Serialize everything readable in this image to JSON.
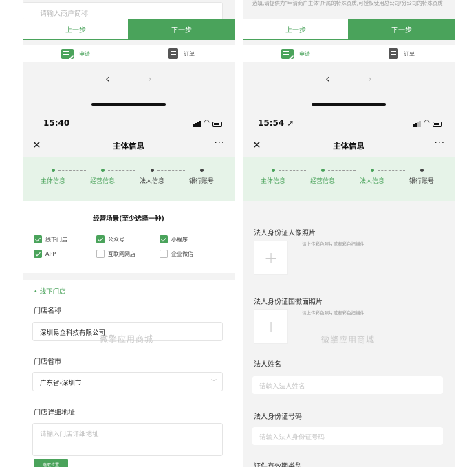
{
  "left_phone": {
    "remnant": {
      "input_placeholder": "请输入商户简称",
      "prev_label": "上一步",
      "next_label": "下一步",
      "tab_apply": "申请",
      "tab_order": "订单",
      "nav_back": "‹",
      "nav_forward": "›"
    },
    "status": {
      "time": "15:40"
    },
    "titlebar": {
      "close": "✕",
      "title": "主体信息",
      "more": "···"
    },
    "steps": [
      {
        "label": "主体信息",
        "state": "done"
      },
      {
        "label": "经营信息",
        "state": "done"
      },
      {
        "label": "法人信息",
        "state": "todo"
      },
      {
        "label": "银行账号",
        "state": "todo"
      }
    ],
    "scenario": {
      "title": "经营场景(至少选择一种)",
      "options": [
        {
          "label": "线下门店",
          "checked": true
        },
        {
          "label": "公众号",
          "checked": true
        },
        {
          "label": "小程序",
          "checked": true
        },
        {
          "label": "APP",
          "checked": true
        },
        {
          "label": "互联网网店",
          "checked": false
        },
        {
          "label": "企业微信",
          "checked": false
        }
      ]
    },
    "offline_store": {
      "heading": "• 线下门店",
      "name_label": "门店名称",
      "name_value": "深圳易企科技有限公司",
      "city_label": "门店省市",
      "city_value": "广东省-深圳市",
      "address_label": "门店详细地址",
      "address_placeholder": "请输入门店详细地址",
      "location_button": "选取位置"
    },
    "watermark": "微擎应用商城"
  },
  "right_phone": {
    "remnant": {
      "hint": "选填,请提供为\"申请商户主体\"所属的特殊资质,可授权使用总公司/分公司的特殊资质",
      "prev_label": "上一步",
      "next_label": "下一步",
      "tab_apply": "申请",
      "tab_order": "订单",
      "nav_back": "‹",
      "nav_forward": "›"
    },
    "status": {
      "time": "15:54 ➚"
    },
    "titlebar": {
      "close": "✕",
      "title": "主体信息",
      "more": "···"
    },
    "steps": [
      {
        "label": "主体信息",
        "state": "done"
      },
      {
        "label": "经营信息",
        "state": "done"
      },
      {
        "label": "法人信息",
        "state": "done"
      },
      {
        "label": "银行账号",
        "state": "todo"
      }
    ],
    "legal_person": {
      "id_front_label": "法人身份证人像照片",
      "id_front_hint": "请上传彩色照片或者彩色扫描件",
      "id_back_label": "法人身份证国徽面照片",
      "id_back_hint": "请上传彩色照片或者彩色扫描件",
      "upload_plus": "+",
      "name_label": "法人姓名",
      "name_placeholder": "请输入法人姓名",
      "id_label": "法人身份证号码",
      "id_placeholder": "请输入法人身份证号码",
      "validity_label": "证件有效期类型"
    },
    "watermark": "微擎应用商城"
  },
  "colors": {
    "accent": "#4aa35b",
    "step_bg": "#e6f3e8"
  }
}
